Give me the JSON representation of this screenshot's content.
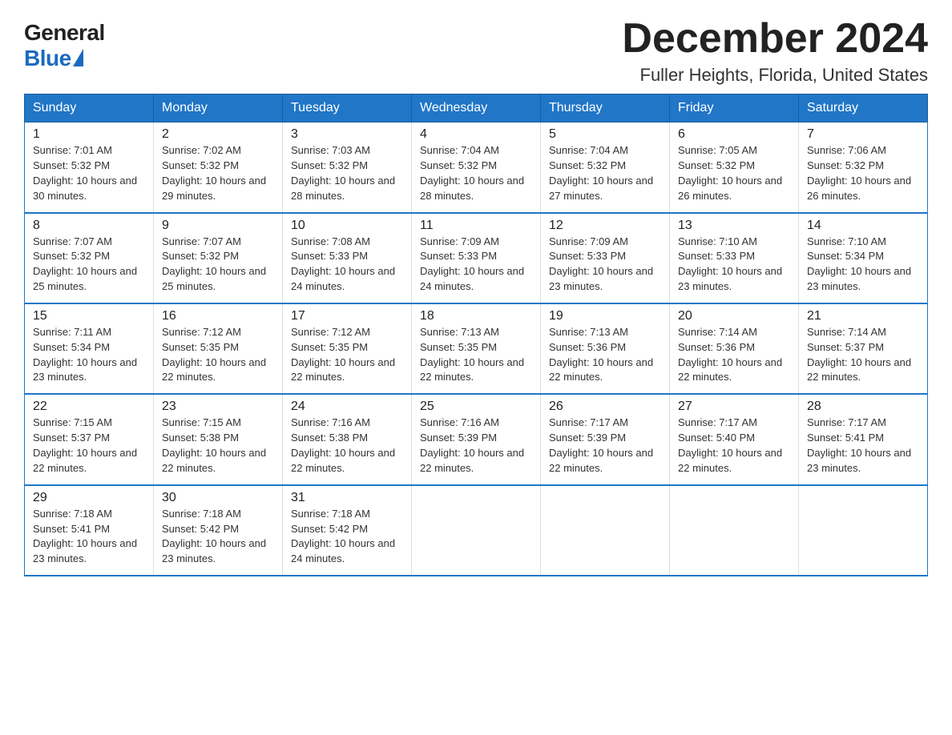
{
  "logo": {
    "general": "General",
    "blue": "Blue"
  },
  "header": {
    "month_year": "December 2024",
    "location": "Fuller Heights, Florida, United States"
  },
  "weekdays": [
    "Sunday",
    "Monday",
    "Tuesday",
    "Wednesday",
    "Thursday",
    "Friday",
    "Saturday"
  ],
  "weeks": [
    [
      {
        "day": "1",
        "sunrise": "7:01 AM",
        "sunset": "5:32 PM",
        "daylight": "10 hours and 30 minutes."
      },
      {
        "day": "2",
        "sunrise": "7:02 AM",
        "sunset": "5:32 PM",
        "daylight": "10 hours and 29 minutes."
      },
      {
        "day": "3",
        "sunrise": "7:03 AM",
        "sunset": "5:32 PM",
        "daylight": "10 hours and 28 minutes."
      },
      {
        "day": "4",
        "sunrise": "7:04 AM",
        "sunset": "5:32 PM",
        "daylight": "10 hours and 28 minutes."
      },
      {
        "day": "5",
        "sunrise": "7:04 AM",
        "sunset": "5:32 PM",
        "daylight": "10 hours and 27 minutes."
      },
      {
        "day": "6",
        "sunrise": "7:05 AM",
        "sunset": "5:32 PM",
        "daylight": "10 hours and 26 minutes."
      },
      {
        "day": "7",
        "sunrise": "7:06 AM",
        "sunset": "5:32 PM",
        "daylight": "10 hours and 26 minutes."
      }
    ],
    [
      {
        "day": "8",
        "sunrise": "7:07 AM",
        "sunset": "5:32 PM",
        "daylight": "10 hours and 25 minutes."
      },
      {
        "day": "9",
        "sunrise": "7:07 AM",
        "sunset": "5:32 PM",
        "daylight": "10 hours and 25 minutes."
      },
      {
        "day": "10",
        "sunrise": "7:08 AM",
        "sunset": "5:33 PM",
        "daylight": "10 hours and 24 minutes."
      },
      {
        "day": "11",
        "sunrise": "7:09 AM",
        "sunset": "5:33 PM",
        "daylight": "10 hours and 24 minutes."
      },
      {
        "day": "12",
        "sunrise": "7:09 AM",
        "sunset": "5:33 PM",
        "daylight": "10 hours and 23 minutes."
      },
      {
        "day": "13",
        "sunrise": "7:10 AM",
        "sunset": "5:33 PM",
        "daylight": "10 hours and 23 minutes."
      },
      {
        "day": "14",
        "sunrise": "7:10 AM",
        "sunset": "5:34 PM",
        "daylight": "10 hours and 23 minutes."
      }
    ],
    [
      {
        "day": "15",
        "sunrise": "7:11 AM",
        "sunset": "5:34 PM",
        "daylight": "10 hours and 23 minutes."
      },
      {
        "day": "16",
        "sunrise": "7:12 AM",
        "sunset": "5:35 PM",
        "daylight": "10 hours and 22 minutes."
      },
      {
        "day": "17",
        "sunrise": "7:12 AM",
        "sunset": "5:35 PM",
        "daylight": "10 hours and 22 minutes."
      },
      {
        "day": "18",
        "sunrise": "7:13 AM",
        "sunset": "5:35 PM",
        "daylight": "10 hours and 22 minutes."
      },
      {
        "day": "19",
        "sunrise": "7:13 AM",
        "sunset": "5:36 PM",
        "daylight": "10 hours and 22 minutes."
      },
      {
        "day": "20",
        "sunrise": "7:14 AM",
        "sunset": "5:36 PM",
        "daylight": "10 hours and 22 minutes."
      },
      {
        "day": "21",
        "sunrise": "7:14 AM",
        "sunset": "5:37 PM",
        "daylight": "10 hours and 22 minutes."
      }
    ],
    [
      {
        "day": "22",
        "sunrise": "7:15 AM",
        "sunset": "5:37 PM",
        "daylight": "10 hours and 22 minutes."
      },
      {
        "day": "23",
        "sunrise": "7:15 AM",
        "sunset": "5:38 PM",
        "daylight": "10 hours and 22 minutes."
      },
      {
        "day": "24",
        "sunrise": "7:16 AM",
        "sunset": "5:38 PM",
        "daylight": "10 hours and 22 minutes."
      },
      {
        "day": "25",
        "sunrise": "7:16 AM",
        "sunset": "5:39 PM",
        "daylight": "10 hours and 22 minutes."
      },
      {
        "day": "26",
        "sunrise": "7:17 AM",
        "sunset": "5:39 PM",
        "daylight": "10 hours and 22 minutes."
      },
      {
        "day": "27",
        "sunrise": "7:17 AM",
        "sunset": "5:40 PM",
        "daylight": "10 hours and 22 minutes."
      },
      {
        "day": "28",
        "sunrise": "7:17 AM",
        "sunset": "5:41 PM",
        "daylight": "10 hours and 23 minutes."
      }
    ],
    [
      {
        "day": "29",
        "sunrise": "7:18 AM",
        "sunset": "5:41 PM",
        "daylight": "10 hours and 23 minutes."
      },
      {
        "day": "30",
        "sunrise": "7:18 AM",
        "sunset": "5:42 PM",
        "daylight": "10 hours and 23 minutes."
      },
      {
        "day": "31",
        "sunrise": "7:18 AM",
        "sunset": "5:42 PM",
        "daylight": "10 hours and 24 minutes."
      },
      {
        "day": "",
        "sunrise": "",
        "sunset": "",
        "daylight": ""
      },
      {
        "day": "",
        "sunrise": "",
        "sunset": "",
        "daylight": ""
      },
      {
        "day": "",
        "sunrise": "",
        "sunset": "",
        "daylight": ""
      },
      {
        "day": "",
        "sunrise": "",
        "sunset": "",
        "daylight": ""
      }
    ]
  ]
}
